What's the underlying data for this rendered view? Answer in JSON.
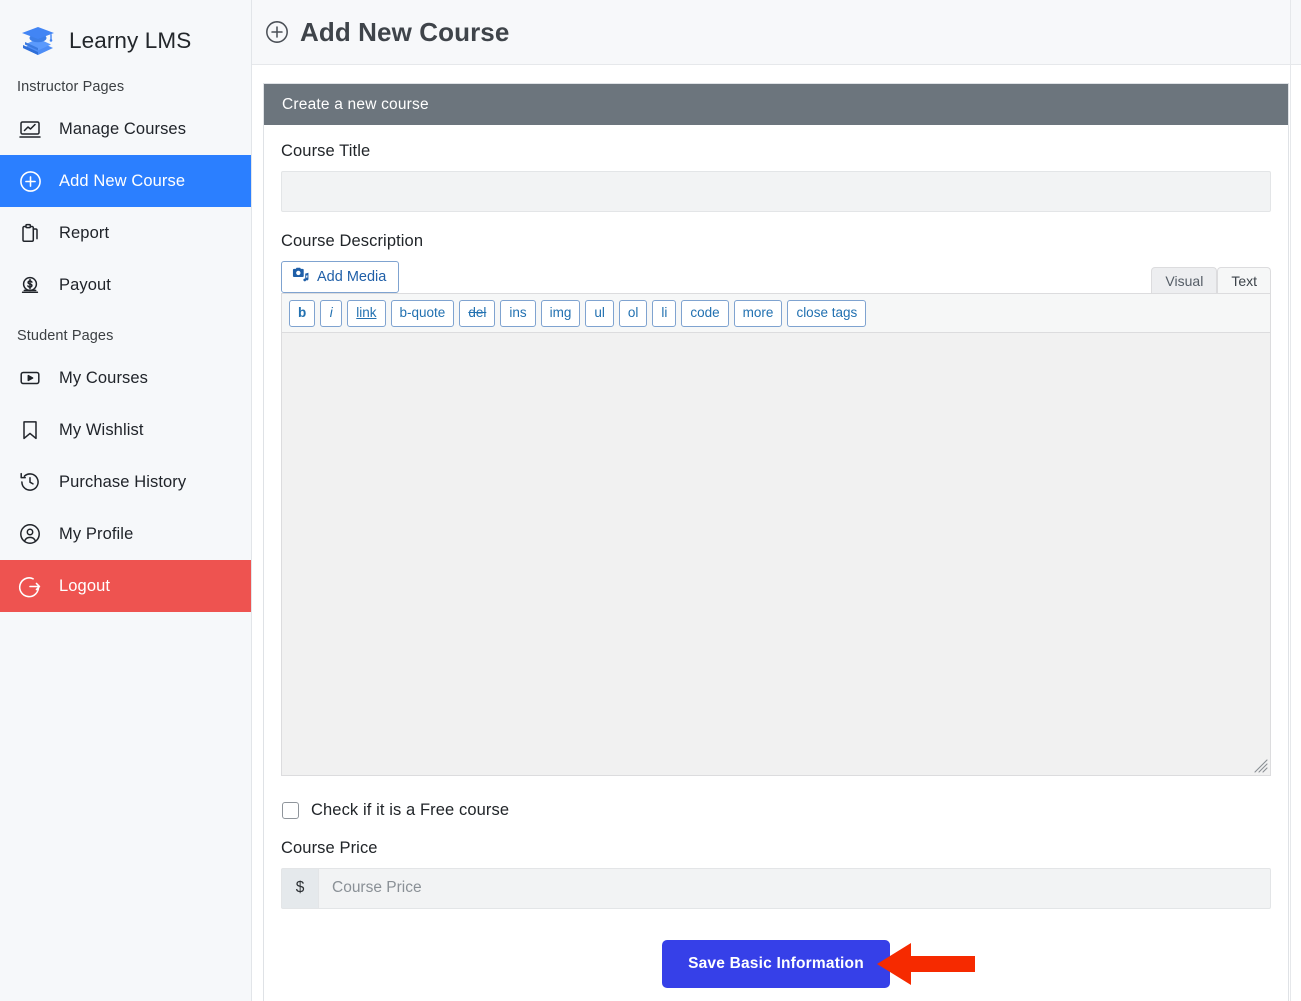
{
  "brand": {
    "name": "Learny LMS",
    "logo_icon": "graduation-cap-books-icon"
  },
  "sidebar": {
    "groups": [
      {
        "label": "Instructor Pages",
        "items": [
          {
            "label": "Manage Courses",
            "icon": "monitor-chart-icon",
            "state": "default"
          },
          {
            "label": "Add New Course",
            "icon": "plus-circle-icon",
            "state": "active"
          },
          {
            "label": "Report",
            "icon": "clipboard-icon",
            "state": "default"
          },
          {
            "label": "Payout",
            "icon": "money-dollar-icon",
            "state": "default"
          }
        ]
      },
      {
        "label": "Student Pages",
        "items": [
          {
            "label": "My Courses",
            "icon": "play-rect-icon",
            "state": "default"
          },
          {
            "label": "My Wishlist",
            "icon": "bookmark-icon",
            "state": "default"
          },
          {
            "label": "Purchase History",
            "icon": "clock-history-icon",
            "state": "default"
          },
          {
            "label": "My Profile",
            "icon": "user-circle-icon",
            "state": "default"
          },
          {
            "label": "Logout",
            "icon": "logout-arrow-icon",
            "state": "danger"
          }
        ]
      }
    ]
  },
  "header": {
    "title": "Add New Course",
    "icon": "plus-circle-icon"
  },
  "card": {
    "title": "Create a new course"
  },
  "form": {
    "course_title": {
      "label": "Course Title",
      "value": "",
      "placeholder": ""
    },
    "course_description": {
      "label": "Course Description",
      "add_media_label": "Add Media",
      "add_media_icon": "media-camera-note-icon",
      "tabs": [
        {
          "label": "Visual",
          "active": false
        },
        {
          "label": "Text",
          "active": true
        }
      ],
      "quicktags": [
        {
          "label": "b",
          "style": "bold"
        },
        {
          "label": "i",
          "style": "italic"
        },
        {
          "label": "link",
          "style": "underline"
        },
        {
          "label": "b-quote",
          "style": "normal"
        },
        {
          "label": "del",
          "style": "strikethrough"
        },
        {
          "label": "ins",
          "style": "normal"
        },
        {
          "label": "img",
          "style": "normal"
        },
        {
          "label": "ul",
          "style": "normal"
        },
        {
          "label": "ol",
          "style": "normal"
        },
        {
          "label": "li",
          "style": "normal"
        },
        {
          "label": "code",
          "style": "normal"
        },
        {
          "label": "more",
          "style": "normal"
        },
        {
          "label": "close tags",
          "style": "normal"
        }
      ],
      "value": ""
    },
    "free_course": {
      "label": "Check if it is a Free course",
      "checked": false
    },
    "course_price": {
      "label": "Course Price",
      "prefix": "$",
      "value": "",
      "placeholder": "Course Price"
    },
    "submit": {
      "label": "Save Basic Information"
    }
  },
  "annotation": {
    "arrow_icon": "red-left-arrow-icon",
    "arrow_color": "#f62a00"
  },
  "colors": {
    "accent_blue": "#2b7fff",
    "danger_red": "#ee5350",
    "card_header_gray": "#6c757d",
    "save_button_blue": "#3640e8",
    "sidebar_bg": "#f6f8fa",
    "annotation_red": "#f62a00"
  }
}
